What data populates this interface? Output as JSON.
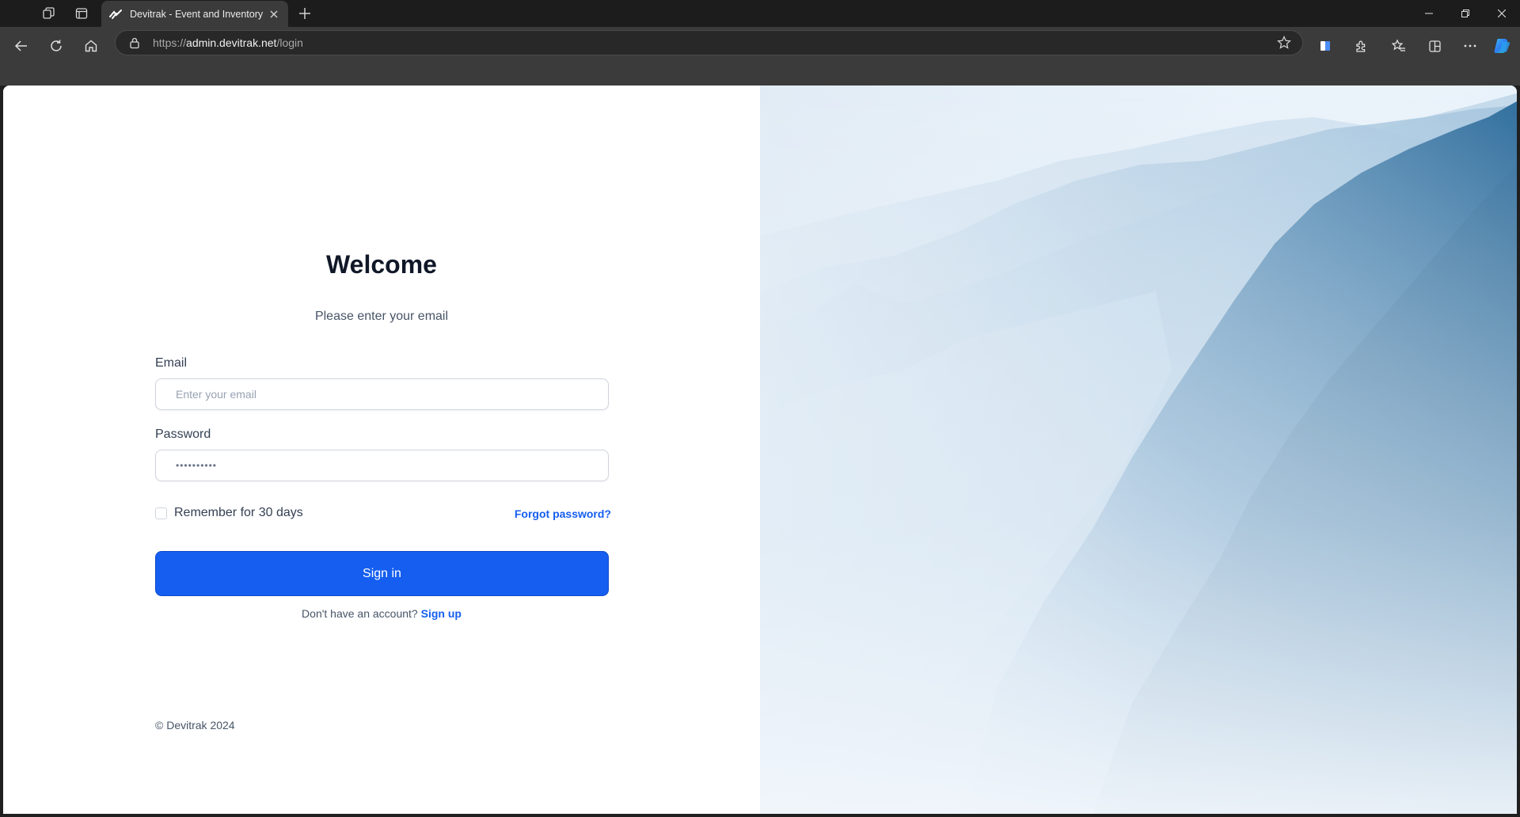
{
  "browser": {
    "tab_title": "Devitrak - Event and Inventory Management",
    "url_scheme": "https://",
    "url_host": "admin.devitrak.net",
    "url_path": "/login",
    "icons": [
      "workspaces-icon",
      "tab-actions-icon",
      "close-icon",
      "new-tab-icon",
      "minimize-icon",
      "restore-icon",
      "close-window-icon",
      "back-icon",
      "refresh-icon",
      "home-icon",
      "lock-icon",
      "favorite-star-icon",
      "reading-icon",
      "extensions-icon",
      "favorites-icon",
      "collections-icon",
      "more-icon",
      "copilot-icon"
    ]
  },
  "login": {
    "title": "Welcome",
    "subtitle": "Please enter your email",
    "email_label": "Email",
    "email_placeholder": "Enter your email",
    "password_label": "Password",
    "password_value": "••••••••••",
    "remember_label": "Remember for 30 days",
    "forgot_label": "Forgot password?",
    "signin_label": "Sign in",
    "signup_prompt": "Don't have an account?",
    "signup_label": "Sign up"
  },
  "footer": {
    "copyright": "© Devitrak 2024"
  },
  "colors": {
    "primary": "#155eef",
    "heading": "#101828",
    "text": "#475467"
  }
}
